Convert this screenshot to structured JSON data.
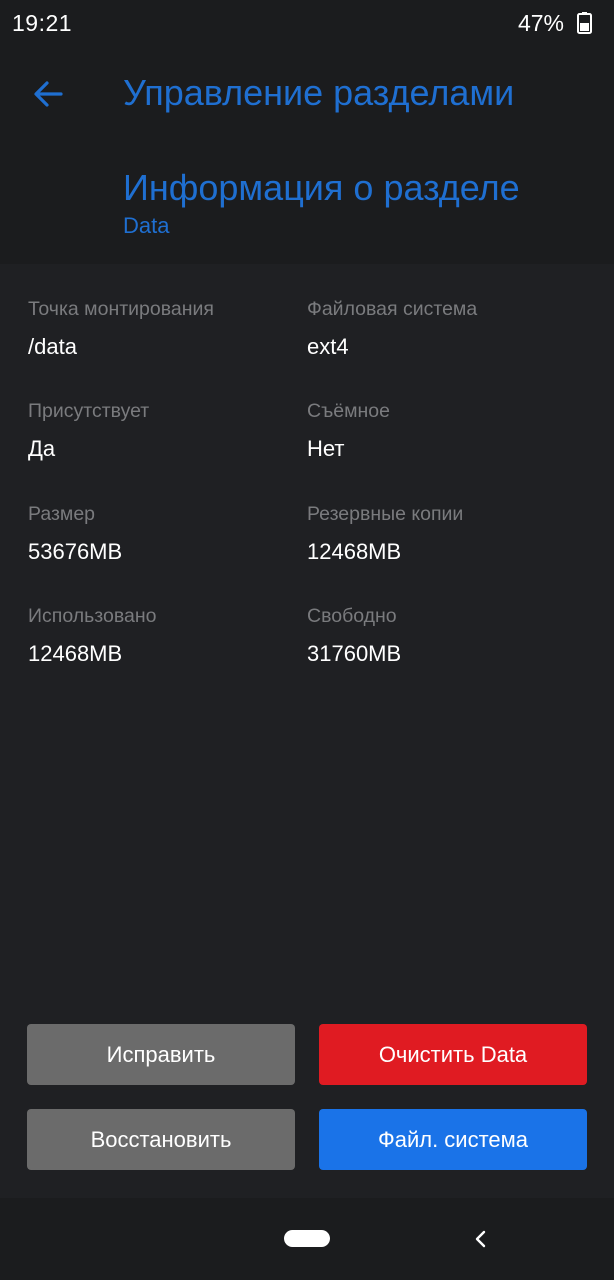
{
  "status_bar": {
    "time": "19:21",
    "battery_percent": "47%",
    "battery_icon": "battery-icon"
  },
  "header": {
    "back_icon": "arrow-left-icon",
    "app_title": "Управление разделами",
    "section_title": "Информация о разделе",
    "section_subtitle": "Data",
    "accent_color": "#1f6fd1"
  },
  "info": {
    "mount_point": {
      "label": "Точка монтирования",
      "value": "/data"
    },
    "file_system": {
      "label": "Файловая система",
      "value": "ext4"
    },
    "present": {
      "label": "Присутствует",
      "value": "Да"
    },
    "removable": {
      "label": "Съёмное",
      "value": "Нет"
    },
    "size": {
      "label": "Размер",
      "value": "53676MB"
    },
    "backups": {
      "label": "Резервные копии",
      "value": "12468MB"
    },
    "used": {
      "label": "Использовано",
      "value": "12468MB"
    },
    "free": {
      "label": "Свободно",
      "value": "31760MB"
    }
  },
  "buttons": {
    "repair": {
      "label": "Исправить",
      "color": "#6b6b6b"
    },
    "wipe": {
      "label": "Очистить Data",
      "color": "#e01b22"
    },
    "restore": {
      "label": "Восстановить",
      "color": "#6b6b6b"
    },
    "file_system": {
      "label": "Файл. система",
      "color": "#1a73e8"
    }
  },
  "nav_bar": {
    "home_icon": "home-pill-icon",
    "back_icon": "chevron-left-icon"
  }
}
